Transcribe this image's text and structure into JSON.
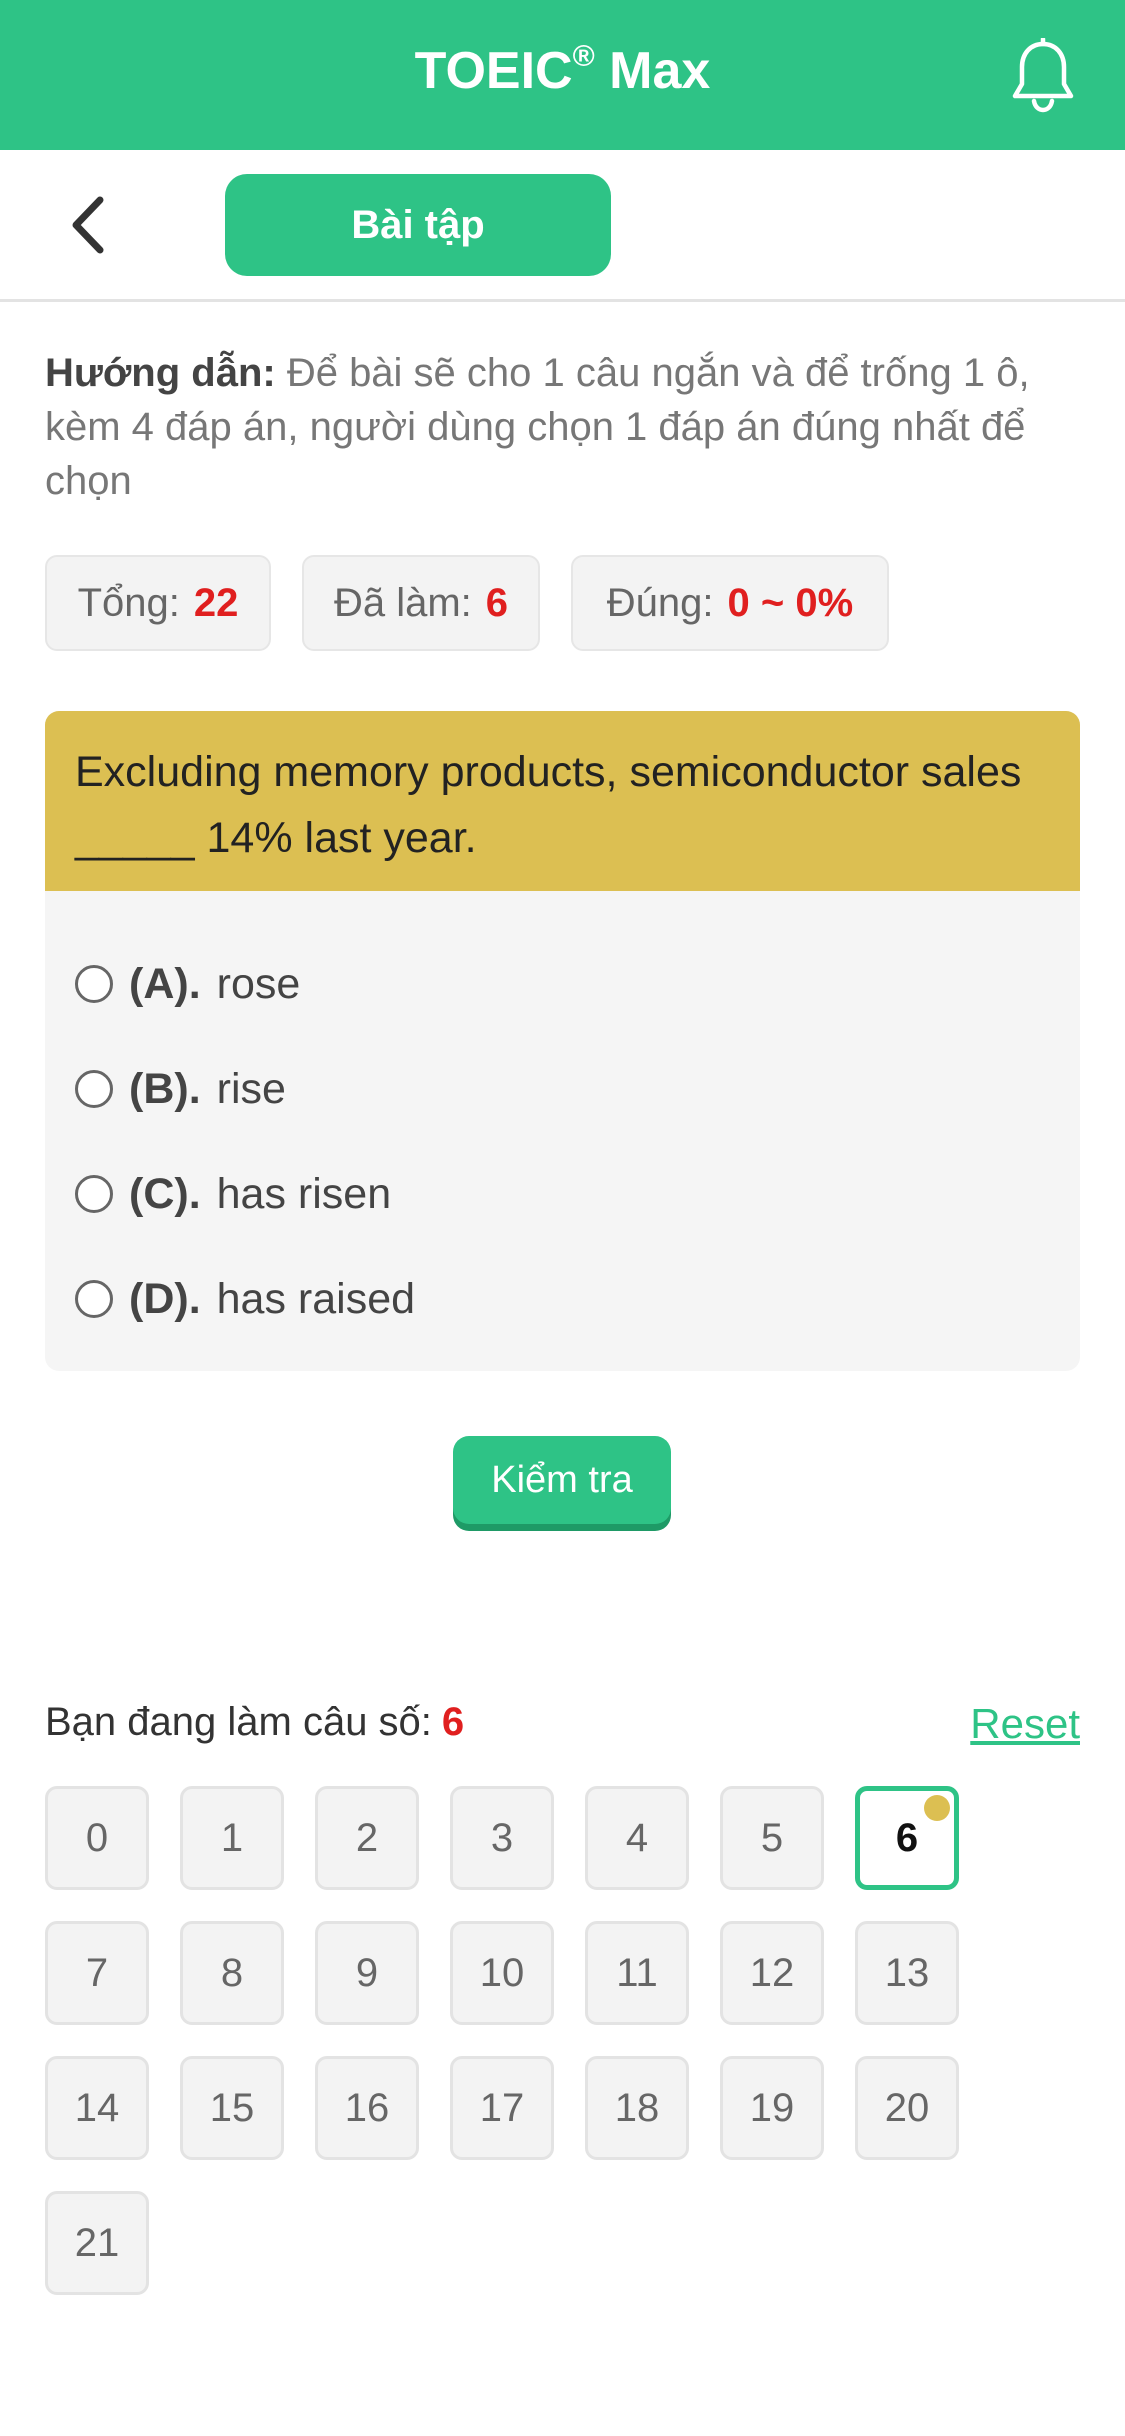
{
  "header": {
    "title": "TOEIC",
    "title_reg": "®",
    "title_suffix": " Max"
  },
  "tab": {
    "label": "Bài tập"
  },
  "instructions": {
    "label": "Hướng dẫn:",
    "text": " Để bài sẽ cho 1 câu ngắn và để trống 1 ô, kèm 4 đáp án, người dùng chọn 1 đáp án đúng nhất để chọn"
  },
  "stats": [
    {
      "label": "Tổng:",
      "value": "22"
    },
    {
      "label": "Đã làm:",
      "value": "6"
    },
    {
      "label": "Đúng:",
      "value": "0 ~ 0%"
    }
  ],
  "question": {
    "text": "Excluding memory products, semiconductor sales _____ 14% last year.",
    "options": [
      {
        "key": "(A).",
        "text": "rose"
      },
      {
        "key": "(B).",
        "text": "rise"
      },
      {
        "key": "(C).",
        "text": "has risen"
      },
      {
        "key": "(D).",
        "text": "has raised"
      }
    ]
  },
  "check_label": "Kiểm tra",
  "progress": {
    "label": "Bạn đang làm câu số:",
    "current": "6",
    "reset": "Reset"
  },
  "grid": [
    "0",
    "1",
    "2",
    "3",
    "4",
    "5",
    "6",
    "7",
    "8",
    "9",
    "10",
    "11",
    "12",
    "13",
    "14",
    "15",
    "16",
    "17",
    "18",
    "19",
    "20",
    "21"
  ],
  "colors": {
    "accent": "#2ec386",
    "highlight": "#dcbf52",
    "error": "#e01f1f"
  },
  "icons": {
    "notification": "bell-icon",
    "back": "chevron-left-icon"
  }
}
